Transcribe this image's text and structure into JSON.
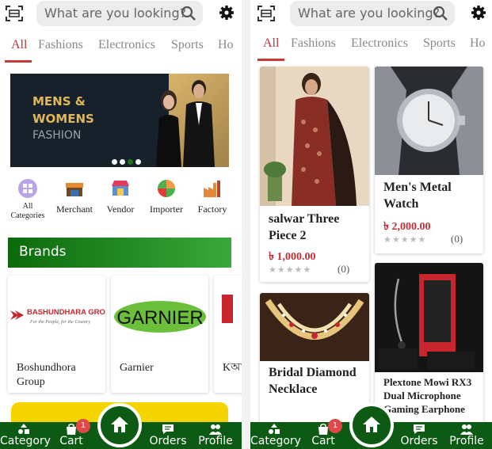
{
  "search": {
    "placeholder": "What are you looking?"
  },
  "tabs": [
    "All",
    "Fashions",
    "Electronics",
    "Sports",
    "Ho"
  ],
  "banner": {
    "line1": "MENS &",
    "line2": "WOMENS",
    "line3": "FASHION"
  },
  "categories": [
    {
      "label": "All Categories",
      "icon": "all-categories-icon"
    },
    {
      "label": "Merchant",
      "icon": "merchant-icon"
    },
    {
      "label": "Vendor",
      "icon": "vendor-icon"
    },
    {
      "label": "Importer",
      "icon": "importer-icon"
    },
    {
      "label": "Factory",
      "icon": "factory-icon"
    }
  ],
  "brands": {
    "heading": "Brands",
    "items": [
      {
        "name": "Boshundhora Group",
        "logo_text": "BASHUNDHARA GROUP",
        "logo_tagline": "For the People, for the Country"
      },
      {
        "name": "Garnier",
        "logo_text": "GARNIER"
      },
      {
        "name": "Kআ",
        "logo_text": ""
      }
    ]
  },
  "products": [
    {
      "name": "salwar Three Piece 2",
      "price": "৳ 1,000.00",
      "reviews": "(0)",
      "rating": 0
    },
    {
      "name": "Men's Metal Watch",
      "price": "৳ 2,000.00",
      "reviews": "(0)",
      "rating": 0
    },
    {
      "name": "Bridal Diamond Necklace",
      "price": "",
      "reviews": "",
      "rating": 0
    },
    {
      "name": "Plextone Mowi RX3 Dual Microphone Gaming Earphone",
      "price": "",
      "reviews": "",
      "rating": 0
    }
  ],
  "bottom_nav": {
    "category": "Category",
    "cart": "Cart",
    "cart_count": "1",
    "orders": "Orders",
    "profile": "Profile"
  },
  "colors": {
    "nav_green": "#0c5a14",
    "accent_red": "#c73a3a",
    "price_red": "#c0303a"
  }
}
